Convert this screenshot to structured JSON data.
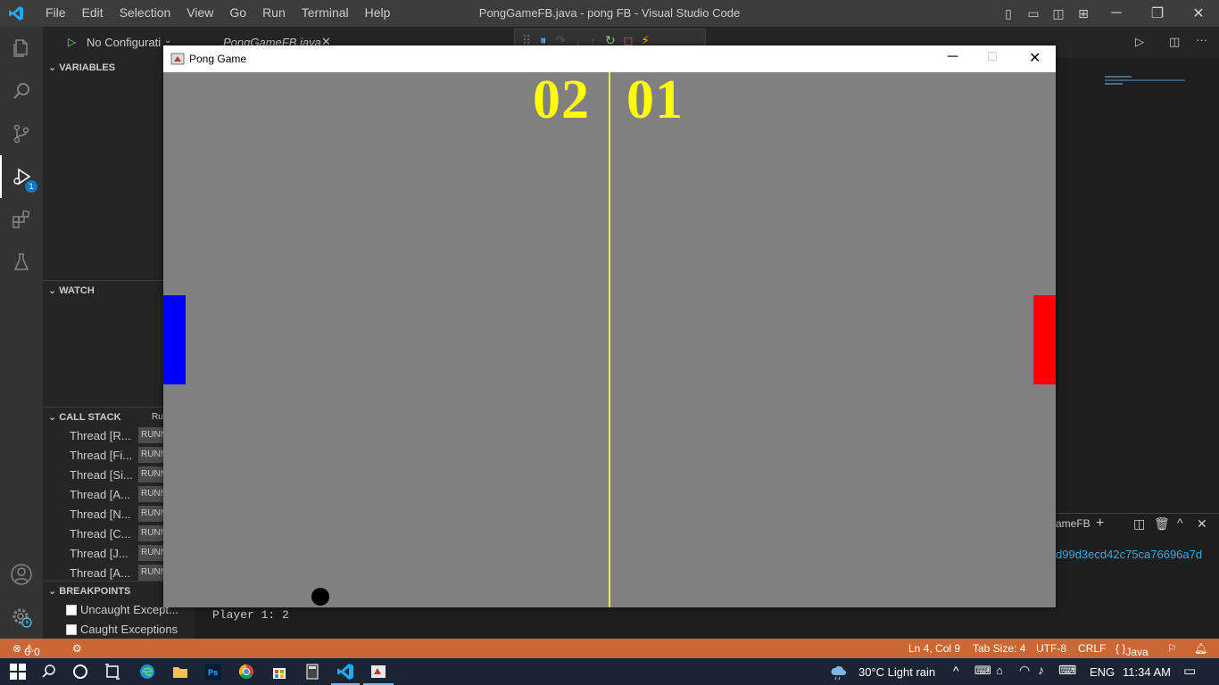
{
  "vscode": {
    "menu": [
      "File",
      "Edit",
      "Selection",
      "View",
      "Go",
      "Run",
      "Terminal",
      "Help"
    ],
    "window_title": "PongGameFB.java - pong FB - Visual Studio Code",
    "run_config": "No Configurati",
    "editor_tab": "PongGameFB.java",
    "activity_badge": "1",
    "sidebar": {
      "variables_header": "VARIABLES",
      "watch_header": "WATCH",
      "callstack_header": "CALL STACK",
      "callstack_tag": "Ru",
      "threads": [
        "Thread [R...",
        "Thread [Fi...",
        "Thread [Si...",
        "Thread [A...",
        "Thread [N...",
        "Thread [C...",
        "Thread [J...",
        "Thread [A..."
      ],
      "thread_status": "RUNN",
      "breakpoints_header": "BREAKPOINTS",
      "breakpoints": [
        "Uncaught Except...",
        "Caught Exceptions"
      ]
    },
    "panel": {
      "tab_label": "ameFB",
      "output_hash": "d99d3ecd42c75ca76696a7d",
      "terminal_line": "Player 1: 2"
    },
    "statusbar": {
      "errors": "0",
      "warnings": "0",
      "position": "Ln 4, Col 9",
      "tab_size": "Tab Size: 4",
      "encoding": "UTF-8",
      "eol": "CRLF",
      "language": "Java"
    }
  },
  "taskbar": {
    "weather": "30°C  Light rain",
    "language": "ENG",
    "time": "11:34 AM"
  },
  "pong": {
    "title": "Pong Game",
    "score_p1": "02",
    "score_p2": "01",
    "colors": {
      "court": "#808080",
      "score": "#ffff00",
      "midline": "#ffff00",
      "paddle1": "#0000ff",
      "paddle2": "#ff0000",
      "ball": "#000000"
    }
  }
}
